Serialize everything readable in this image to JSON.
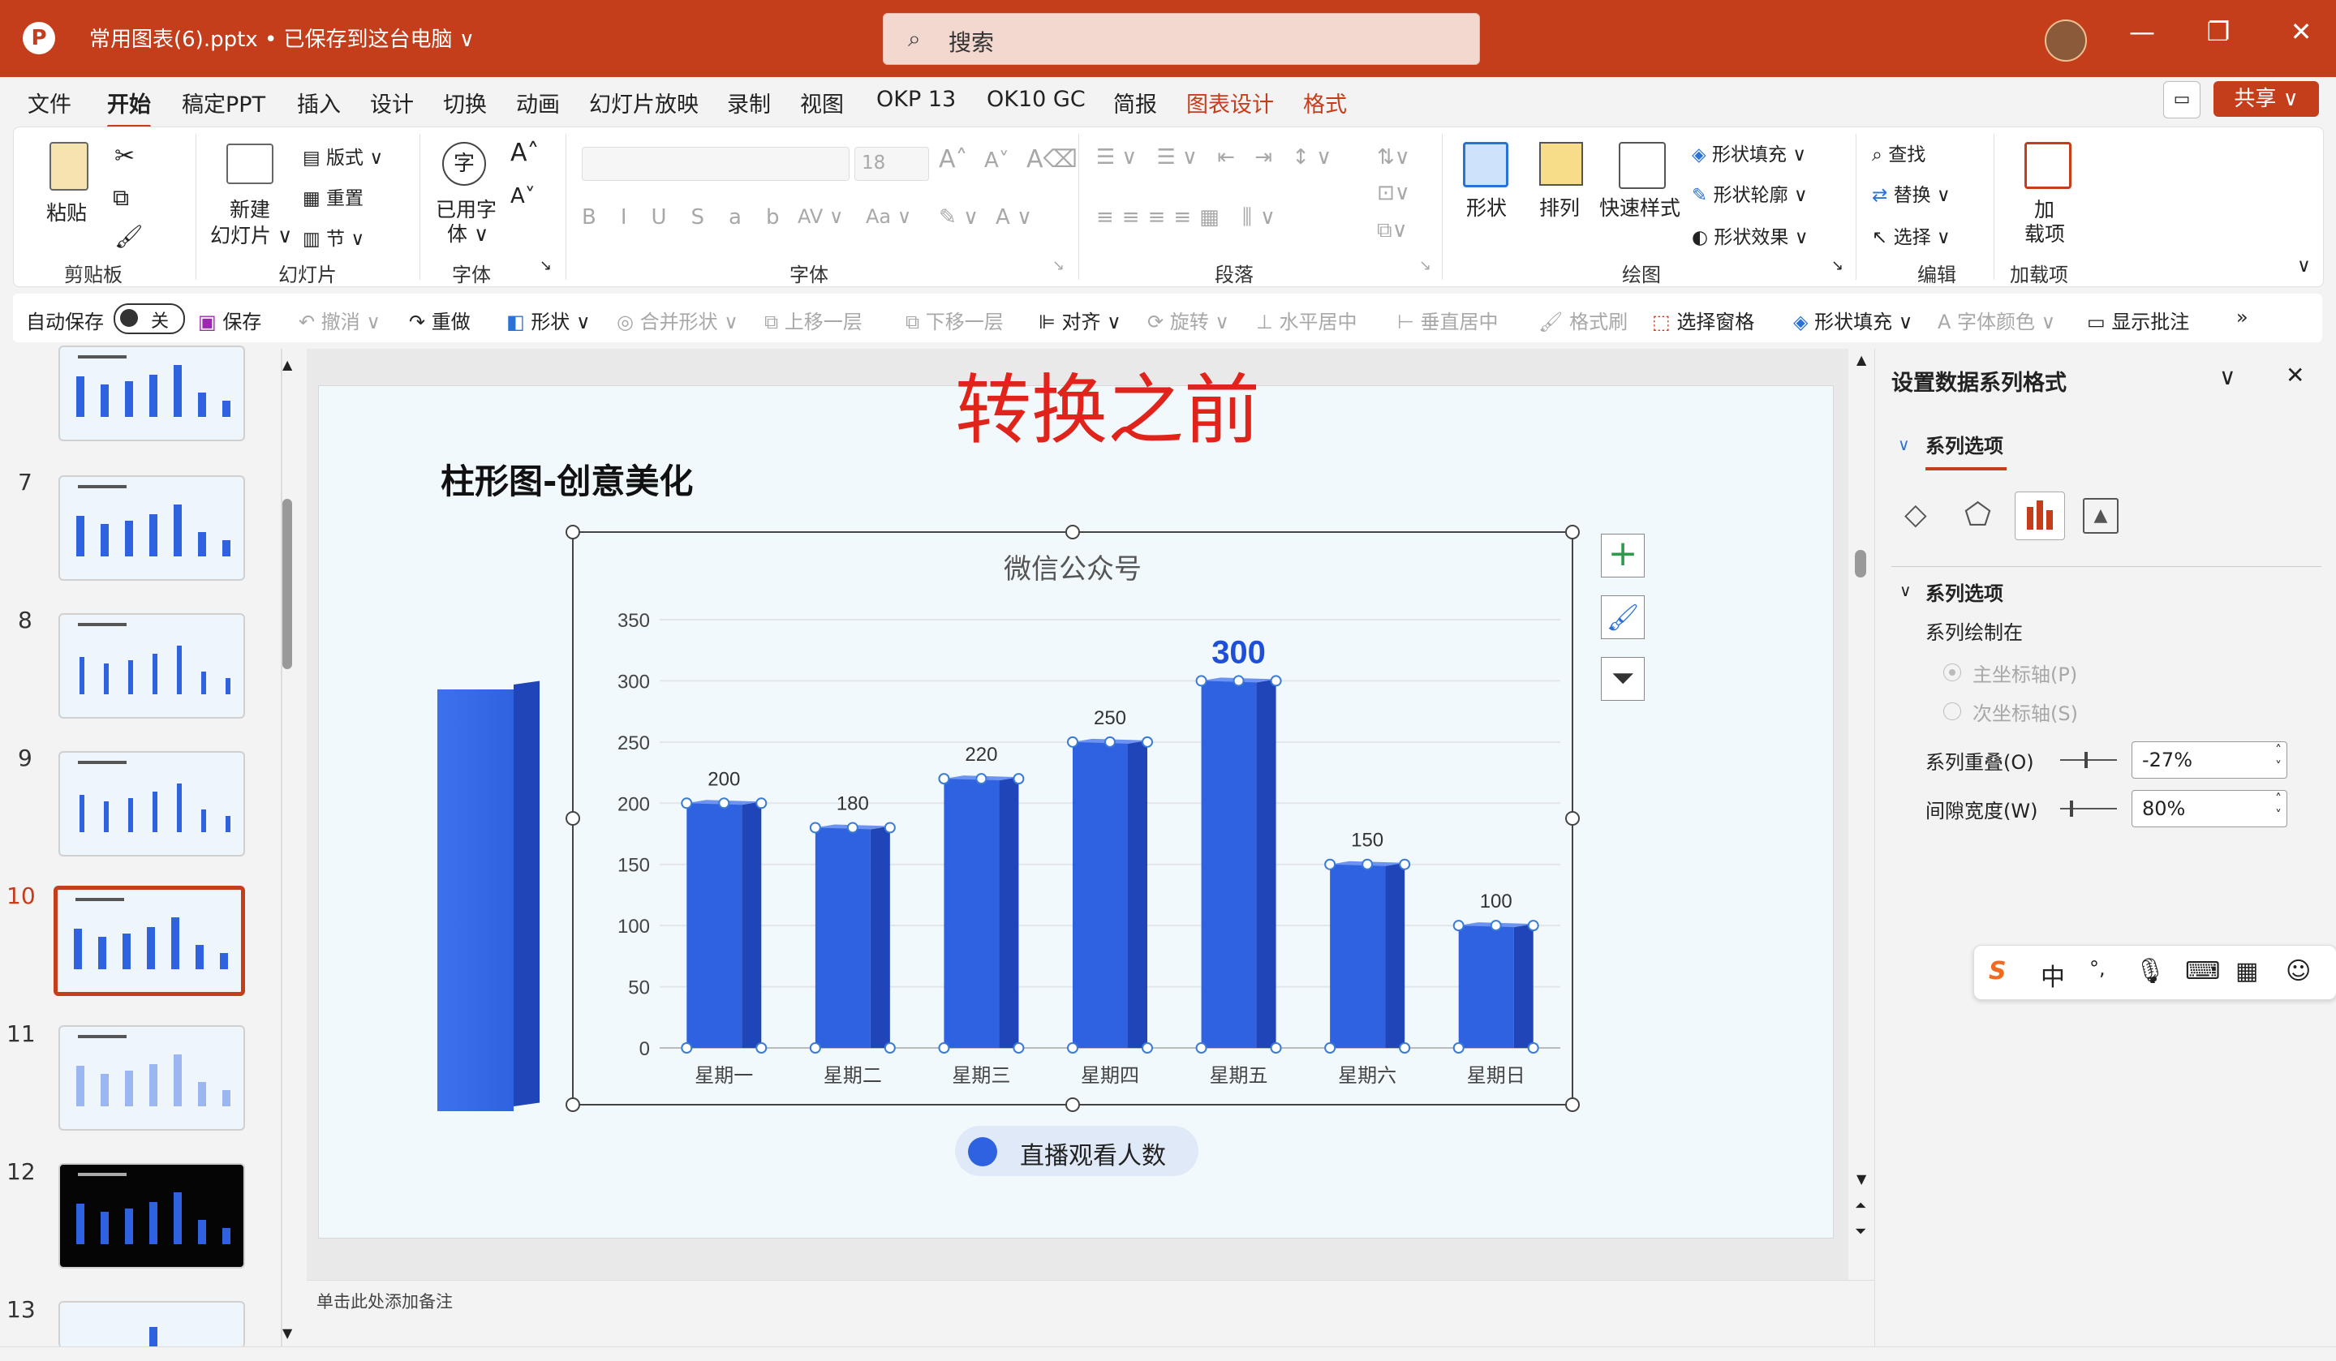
{
  "titlebar": {
    "doc_title": "常用图表(6).pptx • 已保存到这台电脑 ∨",
    "search_placeholder": "搜索",
    "minimize": "—",
    "restore": "❐",
    "close": "✕"
  },
  "tabs": [
    {
      "label": "文件"
    },
    {
      "label": "开始"
    },
    {
      "label": "稿定PPT"
    },
    {
      "label": "插入"
    },
    {
      "label": "设计"
    },
    {
      "label": "切换"
    },
    {
      "label": "动画"
    },
    {
      "label": "幻灯片放映"
    },
    {
      "label": "录制"
    },
    {
      "label": "视图"
    },
    {
      "label": "OKP 13"
    },
    {
      "label": "OK10 GC"
    },
    {
      "label": "简报"
    },
    {
      "label": "图表设计"
    },
    {
      "label": "格式"
    }
  ],
  "share_label": "共享 ∨",
  "ribbon": {
    "clipboard": {
      "paste": "粘贴",
      "group": "剪贴板"
    },
    "slides": {
      "new_slide_1": "新建",
      "new_slide_2": "幻灯片 ∨",
      "layout": "版式 ∨",
      "reset": "重置",
      "section": "节 ∨",
      "group": "幻灯片"
    },
    "font_used": {
      "line1": "已用字",
      "line2": "体 ∨",
      "group": "字体"
    },
    "font": {
      "size": "18",
      "group": "字体"
    },
    "paragraph": {
      "group": "段落"
    },
    "drawing": {
      "shape": "形状",
      "arrange": "排列",
      "quick_style": "快速样式",
      "fill": "形状填充 ∨",
      "outline": "形状轮廓 ∨",
      "effect": "形状效果 ∨",
      "group": "绘图"
    },
    "editing": {
      "find": "查找",
      "replace": "替换",
      "select": "选择 ∨",
      "group": "编辑"
    },
    "addins": {
      "line1": "加",
      "line2": "载项",
      "group": "加载项"
    }
  },
  "qat": {
    "autosave": "自动保存",
    "toggle_state": "关",
    "save": "保存",
    "undo": "撤消",
    "redo": "重做",
    "shape": "形状 ∨",
    "merge": "合并形状 ∨",
    "bring_forward": "上移一层",
    "send_backward": "下移一层",
    "align": "对齐 ∨",
    "rotate": "旋转 ∨",
    "center_h": "水平居中",
    "center_v": "垂直居中",
    "format_painter": "格式刷",
    "selection_pane": "选择窗格",
    "shape_fill": "形状填充 ∨",
    "font_color": "字体颜色 ∨",
    "show_comments": "显示批注",
    "more": "»"
  },
  "thumbnails": [
    {
      "num": "",
      "top": 0
    },
    {
      "num": "7"
    },
    {
      "num": "8"
    },
    {
      "num": "9"
    },
    {
      "num": "10"
    },
    {
      "num": "11"
    },
    {
      "num": "12"
    },
    {
      "num": "13"
    }
  ],
  "slide": {
    "heading_red": "转换之前",
    "title": "柱形图-创意美化",
    "legend_label": "直播观看人数"
  },
  "chart_data": {
    "type": "bar",
    "title": "微信公众号",
    "categories": [
      "星期一",
      "星期二",
      "星期三",
      "星期四",
      "星期五",
      "星期六",
      "星期日"
    ],
    "series": [
      {
        "name": "直播观看人数",
        "values": [
          200,
          180,
          220,
          250,
          300,
          150,
          100
        ]
      }
    ],
    "data_labels": [
      "200",
      "180",
      "220",
      "250",
      "300",
      "150",
      "100"
    ],
    "yticks": [
      "0",
      "50",
      "100",
      "150",
      "200",
      "250",
      "300",
      "350"
    ],
    "ylim": [
      0,
      350
    ],
    "grid": true,
    "legend": "bottom",
    "bar_color": "#2f62e0",
    "highlight_label_color": "#1f4fd8"
  },
  "notes_placeholder": "单击此处添加备注",
  "pane": {
    "title": "设置数据系列格式",
    "section": "系列选项",
    "subsection": "系列选项",
    "plot_on": "系列绘制在",
    "primary_axis": "主坐标轴(P)",
    "secondary_axis": "次坐标轴(S)",
    "overlap_label": "系列重叠(O)",
    "overlap_value": "-27%",
    "gap_label": "间隙宽度(W)",
    "gap_value": "80%"
  },
  "ime": {
    "s": "S",
    "zh": "中",
    "punct": "°,"
  }
}
